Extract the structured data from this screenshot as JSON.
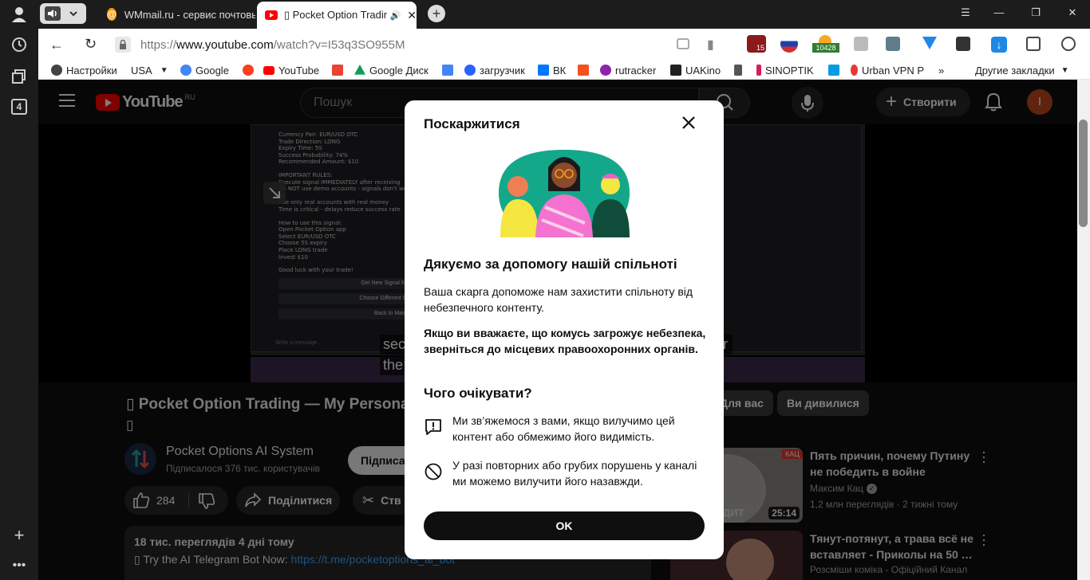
{
  "browser": {
    "tabs": [
      {
        "title": "WMmail.ru - сервис почтовых рассылок"
      },
      {
        "title": "▯ Pocket Option Trading"
      }
    ],
    "url_prefix": "https://",
    "url_host": "www.youtube.com",
    "url_path": "/watch?v=I53q3SO955M",
    "side_badge": "4",
    "extension_badge_1": "15",
    "extension_badge_2": "10428",
    "bookmarks": [
      {
        "label": "Настройки",
        "color": "#444444"
      },
      {
        "label": "USA",
        "color": "#ffffff"
      },
      {
        "label": "Google",
        "color": "#4285f4"
      },
      {
        "label": "",
        "color": "#fc3f1d"
      },
      {
        "label": "YouTube",
        "color": "#ff0000"
      },
      {
        "label": "",
        "color": "#ea4335"
      },
      {
        "label": "Google Диск",
        "color": "#0f9d58"
      },
      {
        "label": "",
        "color": "#4285f4"
      },
      {
        "label": "загрузчик",
        "color": "#2962ff"
      },
      {
        "label": "ВК",
        "color": "#0077ff"
      },
      {
        "label": "",
        "color": "#f4511e"
      },
      {
        "label": "rutracker",
        "color": "#8e24aa"
      },
      {
        "label": "UAKino",
        "color": "#222222"
      },
      {
        "label": "",
        "color": "#555555"
      },
      {
        "label": "SINOPTIK",
        "color": "#d81b60"
      },
      {
        "label": "",
        "color": "#039be5"
      },
      {
        "label": "Urban VPN P",
        "color": "#e53935"
      }
    ],
    "bookmarks_more": "»",
    "other_bookmarks": "Другие закладки"
  },
  "youtube": {
    "logo_text": "YouTube",
    "logo_region": "RU",
    "search_placeholder": "Пошук",
    "create_label": "Створити",
    "avatar_letter": "I",
    "video_title": "▯ Pocket Option Trading — My Persona",
    "video_title_line2": "▯",
    "channel_name": "Pocket Options AI System",
    "subscribers": "Підписалося 376 тис. користувачів",
    "subscribe_label": "Підписа",
    "likes": "284",
    "share_label": "Поділитися",
    "clip_label": "Ств",
    "views_date": "18 тис. переглядів  4 дні тому",
    "desc_prefix": "▯ Try the AI Telegram Bot Now: ",
    "desc_link": "https://t.me/pocketoptions_ai_bot",
    "subtitle_1": "sec",
    "subtitle_2": "the",
    "subtitle_3": "r",
    "chips": [
      "Для вас",
      "Ви дивилися"
    ],
    "recommended": [
      {
        "title": "Пять причин, почему Путину не победить в войне (English…",
        "channel": "Максим Кац",
        "meta": "1,2 млн переглядів · 2 тижні тому",
        "duration": "25:14",
        "badge": "КАЦ",
        "thumb_caption": "ДИТ"
      },
      {
        "title": "Тянут-потянут, а трава всё не вставляет - Приколы на 50 …",
        "channel": "Розсміши коміка - Офіційний Канал",
        "meta": "",
        "duration": "",
        "badge": "",
        "thumb_caption": ""
      }
    ],
    "chat_lines": [
      "Currency Pair: EUR/USD OTC",
      "Trade Direction: LONG",
      "Expiry Time: 5S",
      "Success Probability: 74%",
      "Recommended Amount: $10",
      "",
      "IMPORTANT RULES:",
      "Execute signal IMMEDIATELY after receiving",
      "Do NOT use demo accounts - signals don't wo",
      "rk",
      "Use only real accounts with real money",
      "Time is critical - delays reduce success rate",
      "",
      "How to use this signal:",
      "Open Pocket Option app",
      "Select EUR/USD OTC",
      "Choose 5S expiry",
      "Place LONG trade",
      "Invest $10",
      "",
      "Good luck with your trade!"
    ],
    "chat_buttons": [
      "Get New Signal for Same Pair",
      "Choose Different Currency Pair",
      "Back to Main Menu"
    ],
    "chat_input": "Write a message..."
  },
  "dialog": {
    "title": "Поскаржитися",
    "heading": "Дякуємо за допомогу нашій спільноті",
    "para1": "Ваша скарга допоможе нам захистити спільноту від небезпечного контенту.",
    "para2": "Якщо ви вважаєте, що комусь загрожує небезпека, зверніться до місцевих правоохоронних органів.",
    "expect_heading": "Чого очікувати?",
    "item1": "Ми зв’яжемося з вами, якщо вилучимо цей контент або обмежимо його видимість.",
    "item2": "У разі повторних або грубих порушень у каналі ми можемо вилучити його назавжди.",
    "ok_label": "OK"
  }
}
